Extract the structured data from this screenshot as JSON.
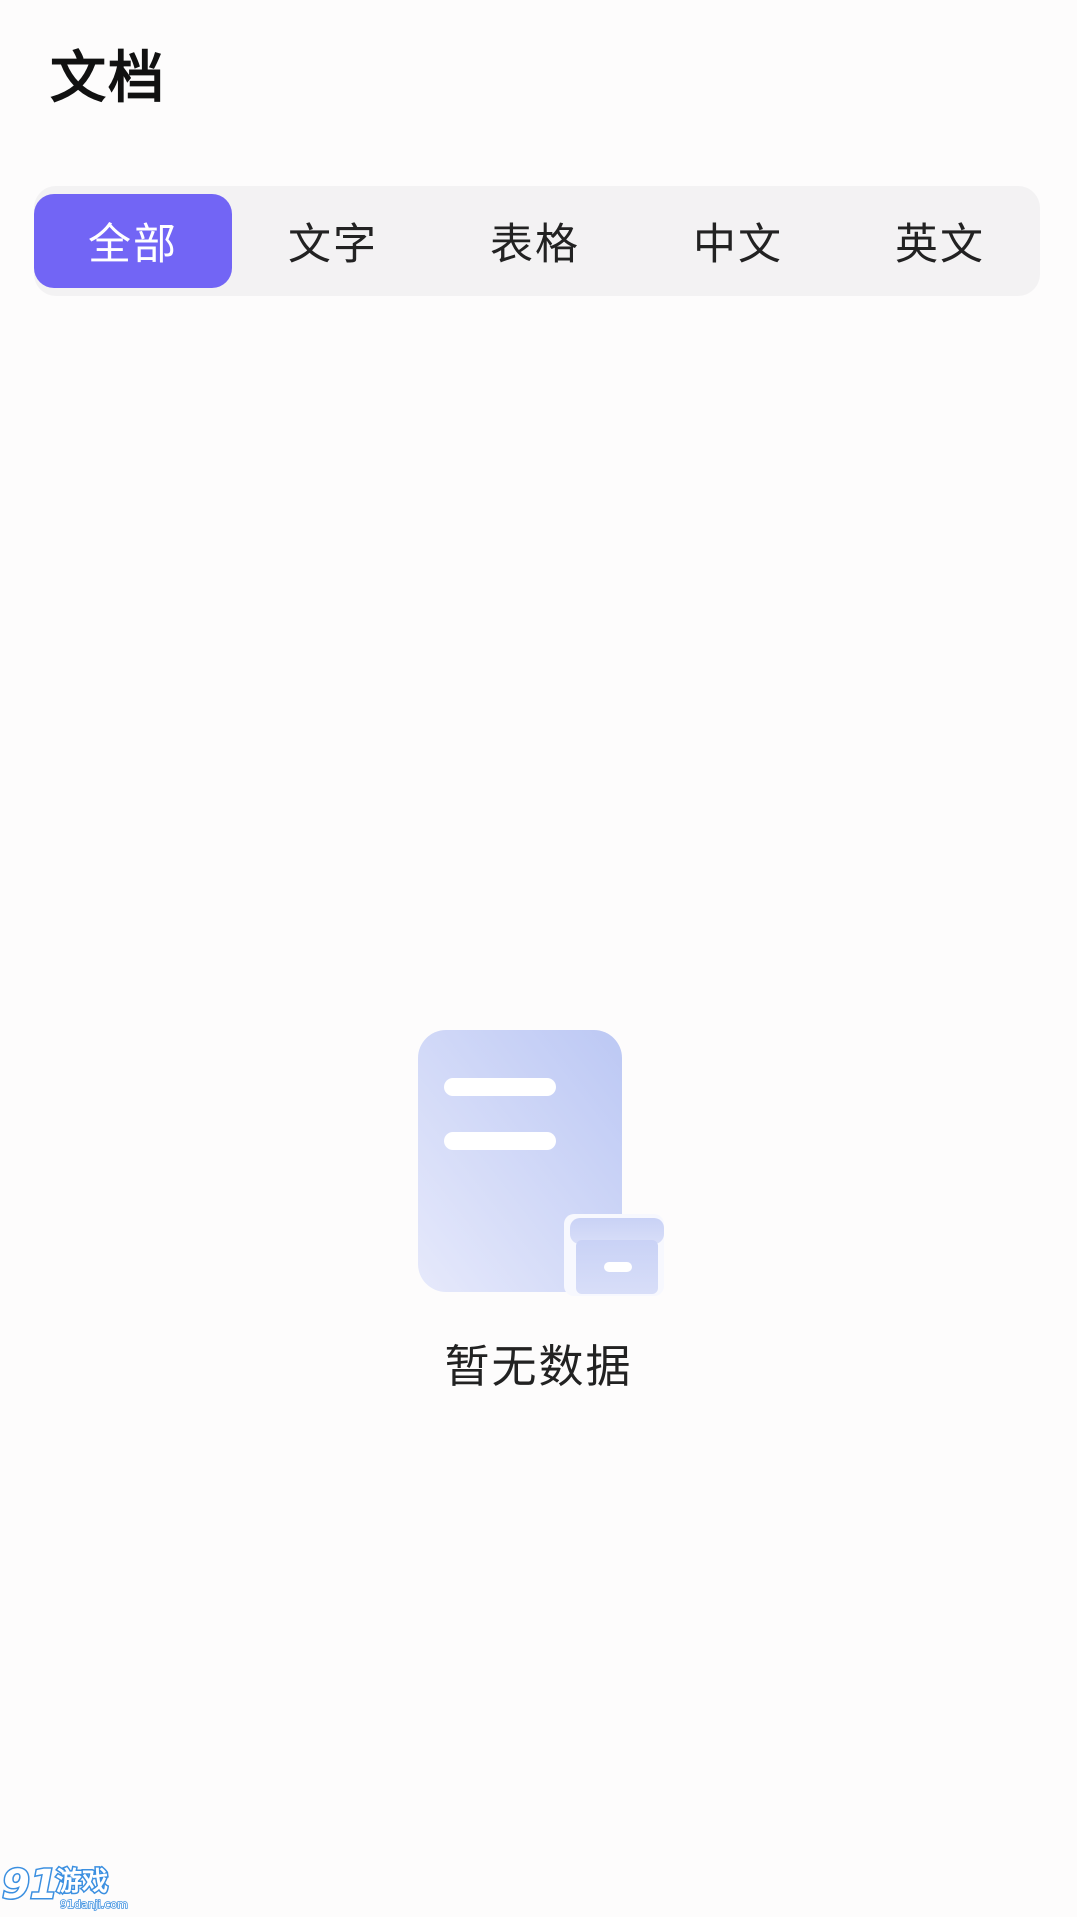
{
  "header": {
    "title": "文档"
  },
  "tabs": [
    {
      "label": "全部",
      "active": true
    },
    {
      "label": "文字",
      "active": false
    },
    {
      "label": "表格",
      "active": false
    },
    {
      "label": "中文",
      "active": false
    },
    {
      "label": "英文",
      "active": false
    }
  ],
  "empty_state": {
    "icon": "empty-document-icon",
    "message": "暂无数据"
  },
  "watermark": {
    "text": "91游戏",
    "subtext": "91danji.com"
  },
  "colors": {
    "accent": "#7265f5",
    "tabbar_bg": "#f3f2f3",
    "page_bg": "#fdfcfc",
    "illustration_light": "#e6e9fb",
    "illustration_dark": "#bcc8f4"
  }
}
